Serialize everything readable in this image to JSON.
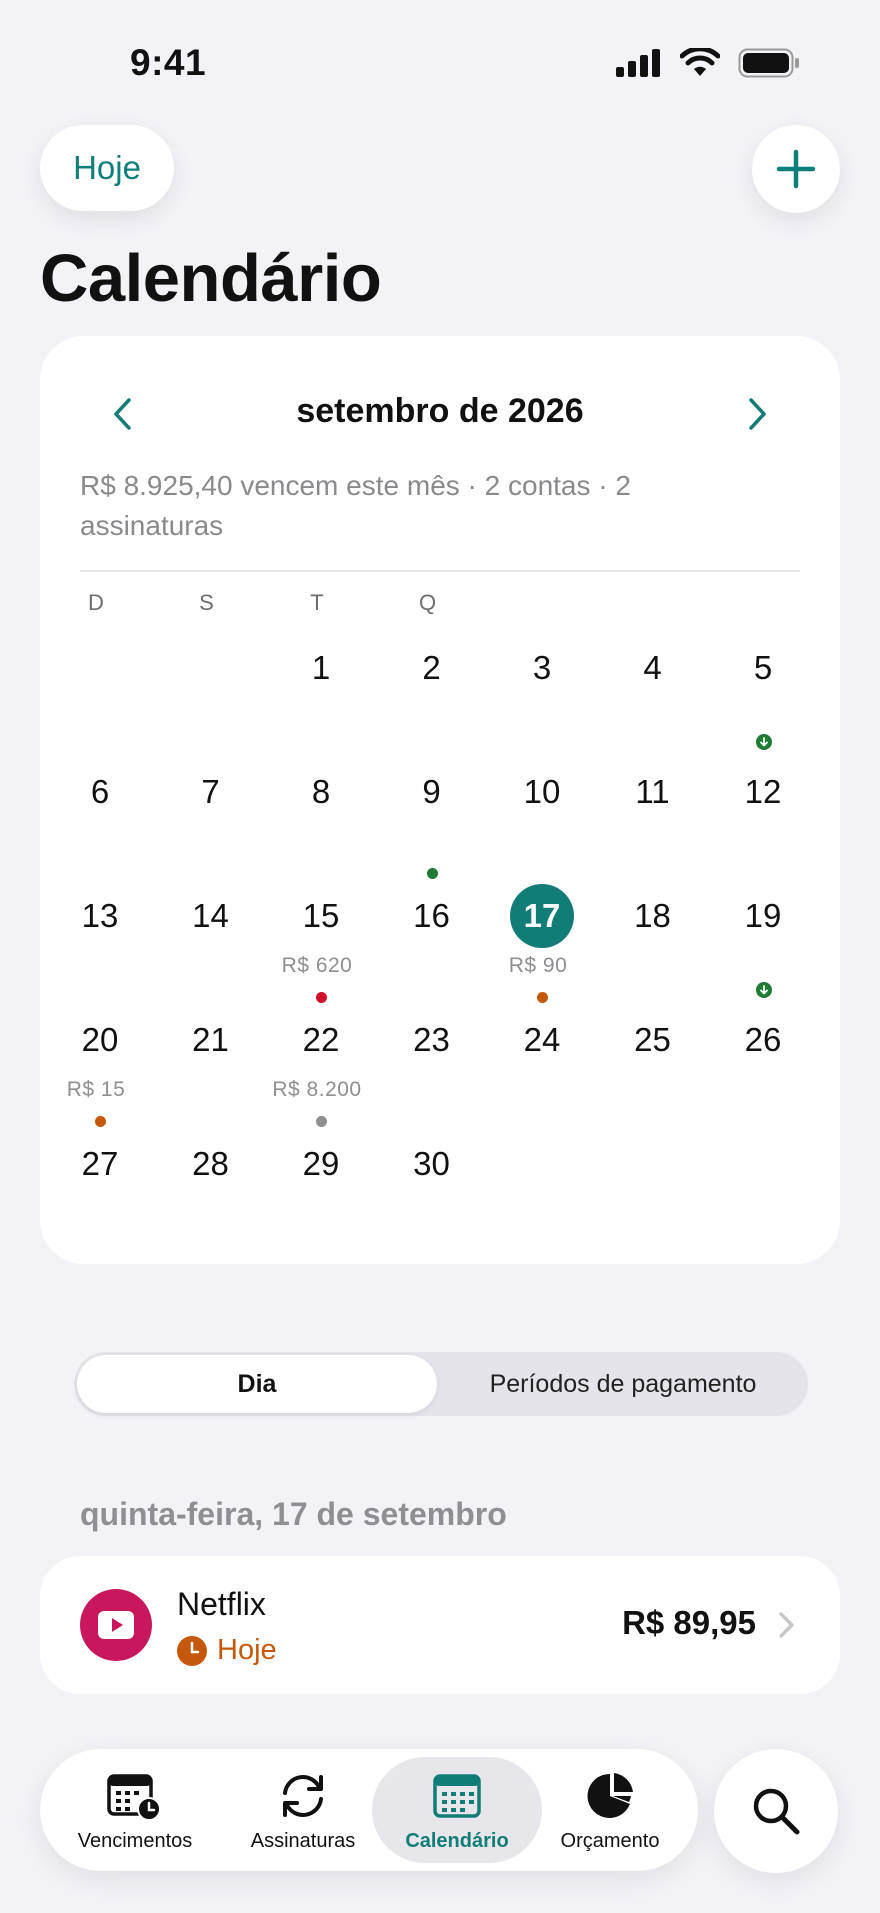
{
  "status_bar": {
    "time": "9:41"
  },
  "header": {
    "today_label": "Hoje",
    "title": "Calendário"
  },
  "calendar": {
    "month_label": "setembro de 2026",
    "summary": "R$ 8.925,40 vencem este mês · 2 contas · 2 assinaturas",
    "weekdays": [
      "D",
      "S",
      "T",
      "Q",
      "",
      "",
      ""
    ],
    "selected_day": "17",
    "days": [
      {
        "num": "1"
      },
      {
        "num": "2"
      },
      {
        "num": "3"
      },
      {
        "num": "4"
      },
      {
        "num": "5",
        "marker": "income"
      },
      {
        "num": "6"
      },
      {
        "num": "7"
      },
      {
        "num": "8"
      },
      {
        "num": "9",
        "marker": "#1e7b34"
      },
      {
        "num": "10"
      },
      {
        "num": "11"
      },
      {
        "num": "12"
      },
      {
        "num": "13"
      },
      {
        "num": "14"
      },
      {
        "num": "15",
        "amount": "R$ 620",
        "marker": "#d0112b"
      },
      {
        "num": "16"
      },
      {
        "num": "17",
        "amount": "R$ 90",
        "marker": "#c4590c"
      },
      {
        "num": "18"
      },
      {
        "num": "19",
        "marker": "income"
      },
      {
        "num": "20",
        "amount": "R$ 15",
        "marker": "#c4590c"
      },
      {
        "num": "21"
      },
      {
        "num": "22",
        "amount": "R$ 8.200",
        "marker": "#8e8e93"
      },
      {
        "num": "23"
      },
      {
        "num": "24"
      },
      {
        "num": "25"
      },
      {
        "num": "26"
      },
      {
        "num": "27"
      },
      {
        "num": "28"
      },
      {
        "num": "29"
      },
      {
        "num": "30"
      }
    ]
  },
  "segmented": {
    "day_label": "Dia",
    "periods_label": "Períodos de pagamento"
  },
  "day_section": {
    "heading": "quinta-feira, 17 de setembro",
    "items": [
      {
        "name": "Netflix",
        "status": "Hoje",
        "amount": "R$ 89,95",
        "logo_color": "#c8175d"
      }
    ]
  },
  "tab_bar": {
    "tabs": [
      {
        "label": "Vencimentos",
        "icon": "calendar-clock-icon"
      },
      {
        "label": "Assinaturas",
        "icon": "refresh-icon"
      },
      {
        "label": "Calendário",
        "icon": "calendar-grid-icon",
        "active": true
      },
      {
        "label": "Orçamento",
        "icon": "pie-chart-icon"
      }
    ]
  },
  "colors": {
    "accent": "#127c76",
    "text_muted": "#8e8e93",
    "due_today": "#c4590c",
    "overdue": "#d0112b",
    "income": "#1e7b34"
  }
}
